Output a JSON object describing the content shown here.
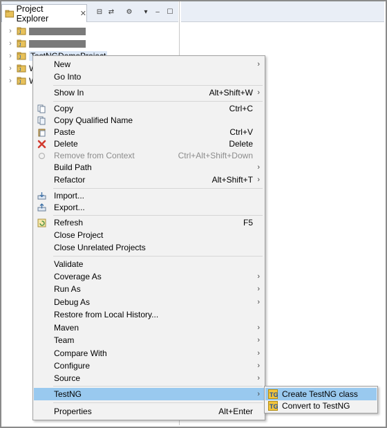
{
  "explorer": {
    "tab_label": "Project Explorer",
    "tree": [
      {
        "label": "",
        "redacted": true
      },
      {
        "label": "",
        "redacted": true
      },
      {
        "label": "TestNGDemoProject",
        "selected": true
      },
      {
        "label": "W"
      },
      {
        "label": "W"
      }
    ]
  },
  "context_menu": {
    "items": {
      "new": {
        "label": "New"
      },
      "go_into": {
        "label": "Go Into"
      },
      "show_in": {
        "label": "Show In",
        "shortcut": "Alt+Shift+W"
      },
      "copy": {
        "label": "Copy",
        "shortcut": "Ctrl+C"
      },
      "copy_qualified_name": {
        "label": "Copy Qualified Name"
      },
      "paste": {
        "label": "Paste",
        "shortcut": "Ctrl+V"
      },
      "delete": {
        "label": "Delete",
        "shortcut": "Delete"
      },
      "remove_from_context": {
        "label": "Remove from Context",
        "shortcut": "Ctrl+Alt+Shift+Down"
      },
      "build_path": {
        "label": "Build Path"
      },
      "refactor": {
        "label": "Refactor",
        "shortcut": "Alt+Shift+T"
      },
      "import": {
        "label": "Import..."
      },
      "export": {
        "label": "Export..."
      },
      "refresh": {
        "label": "Refresh",
        "shortcut": "F5"
      },
      "close_project": {
        "label": "Close Project"
      },
      "close_unrelated_projects": {
        "label": "Close Unrelated Projects"
      },
      "validate": {
        "label": "Validate"
      },
      "coverage_as": {
        "label": "Coverage As"
      },
      "run_as": {
        "label": "Run As"
      },
      "debug_as": {
        "label": "Debug As"
      },
      "restore_from_local_history": {
        "label": "Restore from Local History..."
      },
      "maven": {
        "label": "Maven"
      },
      "team": {
        "label": "Team"
      },
      "compare_with": {
        "label": "Compare With"
      },
      "configure": {
        "label": "Configure"
      },
      "source": {
        "label": "Source"
      },
      "testng": {
        "label": "TestNG"
      },
      "properties": {
        "label": "Properties",
        "shortcut": "Alt+Enter"
      }
    }
  },
  "testng_submenu": {
    "create_testng_class": "Create TestNG class",
    "convert_to_testng": "Convert to TestNG"
  },
  "colors": {
    "highlight": "#99c9ef",
    "menu_bg": "#f2f2f2",
    "delete_icon": "#d23a2e"
  }
}
